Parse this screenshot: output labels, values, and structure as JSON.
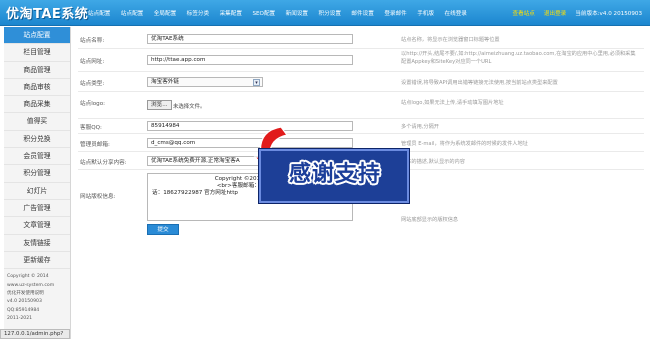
{
  "app": {
    "logo": "优淘TAE系统"
  },
  "topnav": [
    "站点配置",
    "站点配置",
    "全局配置",
    "标签分类",
    "采集配置",
    "SEO配置",
    "新闻设置",
    "积分设置",
    "邮件设置",
    "登录邮件",
    "手机版",
    "在线登录"
  ],
  "topright": {
    "view_site": "查看站点",
    "logout": "退出登录",
    "version": "当前版本:v4.0 20150903"
  },
  "sidebar": {
    "items": [
      "站点配置",
      "栏目管理",
      "商品管理",
      "商品审核",
      "商品采集",
      "值得买",
      "积分兑换",
      "会员管理",
      "积分管理",
      "幻灯片",
      "广告管理",
      "文章管理",
      "友情链接",
      "更新缓存"
    ],
    "footer": [
      "Copyright © 2014",
      "www.uz-system.com",
      "优化开发使用说明",
      "v4.0 20150903",
      "QQ:85914984",
      "2011-2021"
    ]
  },
  "form": {
    "site_name": {
      "label": "站点名称:",
      "value": "优淘TAE系统",
      "hint": "站点名称，将显示在浏览器窗口标题等位置"
    },
    "site_url": {
      "label": "站点网址:",
      "value": "http://ttae.app.com",
      "hint": "以http://开头,结尾不要/,如:http://aimeizhuang.uz.taobao.com,在淘宝的应用中心里用,必须和采集配置Appkey和SiteKey对应同一个URL"
    },
    "site_type": {
      "label": "站点类型:",
      "value": "淘宝客外链",
      "hint": "设置错误,将导致API调用出错等链接无法使用,按当前站点类型来配置"
    },
    "site_logo": {
      "label": "站点logo:",
      "button": "浏览...",
      "file_text": "未选择文件。",
      "hint": "站点logo,如果无法上传,请手动填写图片地址"
    },
    "qq": {
      "label": "客服QQ:",
      "value": "85914984",
      "hint": "多个请用,分隔开"
    },
    "admin_email": {
      "label": "管理员邮箱:",
      "value": "d_cms@qq.com",
      "hint": "管理员 E-mail，将作为系统发邮件的时候的发件人地址"
    },
    "share": {
      "label": "站点默认分享内容:",
      "value": "优淘TAE系统免费开源,正常淘宝客A",
      "hint": "文本的描述,默认显示的内容"
    },
    "footer_info": {
      "label": "网站版权信息:",
      "line1": "Copyright ©2015 uz-syst",
      "line2": "<br>客服邮箱：d_cms@",
      "line3": "话：18627922987 官方网址http",
      "hint": "网站底部显示的版权信息"
    },
    "submit": "提交"
  },
  "statusbar": "127.0.0.1/admin.php?",
  "overlay": {
    "text": "感谢支持"
  }
}
